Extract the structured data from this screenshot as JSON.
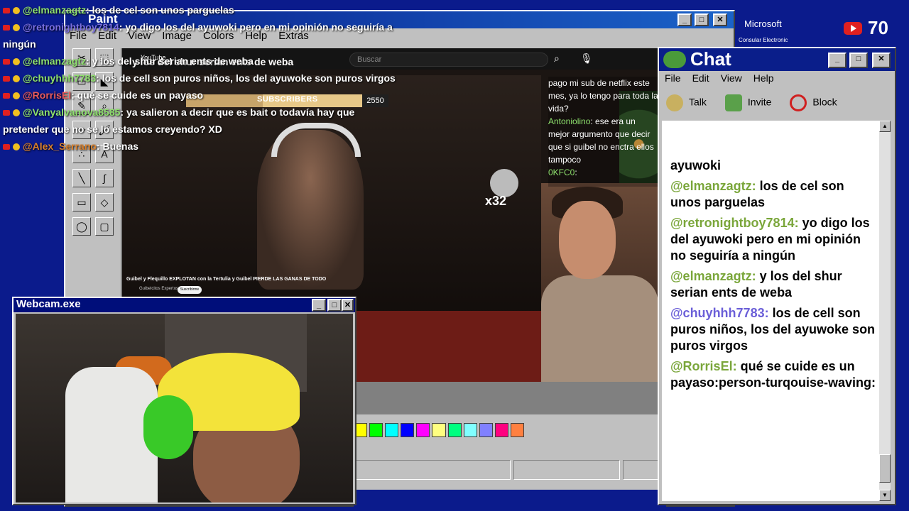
{
  "paint": {
    "title": "Paint",
    "menu": [
      "File",
      "Edit",
      "View",
      "Image",
      "Colors",
      "Help",
      "Extras"
    ],
    "palette": [
      "#ffff00",
      "#00ff00",
      "#00ffff",
      "#0000ff",
      "#ff00ff",
      "#ffff80",
      "#00ff80",
      "#80ffff",
      "#8080ff",
      "#ff0080",
      "#ff8040"
    ]
  },
  "stream": {
    "brand": "YouTube",
    "search_placeholder": "Buscar",
    "title": "y los del shur serian ents de weba",
    "subscribers_label": "SUBSCRIBERS",
    "subscribers_count": "2550",
    "subscribers_progress": 0.38,
    "sticker_text": "x32",
    "video_caption": "Guibel y Flequillo EXPLOTAN con la Tertulia y Guibel PIERDE LAS GANAS DE TODO",
    "channel": "Guibelcitos Expertos",
    "subscribe": "Suscribirme"
  },
  "side_chat": [
    {
      "text": "pago mi sub de netflix este mes, ya lo tengo para toda la vida?",
      "user": ""
    },
    {
      "user": "Antoniolino",
      "text": ": ese era un mejor argumento que decir que si guibel no enctra ellos tampoco"
    },
    {
      "user": "0KFC0",
      "text": ":"
    }
  ],
  "overlay_chat": [
    {
      "user": "@elmanzagtz",
      "text": ": los de cel son unos parguelas",
      "cls": "u1"
    },
    {
      "user": "@retronightboy7814",
      "text": ": yo digo los del ayuwoki pero en mi opinión no seguiría a ningún",
      "cls": "u2"
    },
    {
      "user": "@elmanzagtz",
      "text": ": y los del shur serian ents de weba",
      "cls": "u1"
    },
    {
      "user": "@chuyhhh7783",
      "text": ": los de cell son puros niños, los del ayuwoke son puros virgos",
      "cls": "u1"
    },
    {
      "user": "@RorrisEl",
      "text": ": qué se cuide es un payaso",
      "cls": "u3"
    },
    {
      "user": "@Vanyalvanova8585",
      "text": ": ya salieron a decir que es bait o todavía hay que pretender que no se lo estamos creyendo? XD",
      "cls": "u1"
    },
    {
      "user": "@Alex_Serrano",
      "text": ": Buenas",
      "cls": "u4"
    }
  ],
  "webcam": {
    "title": "Webcam.exe"
  },
  "chat": {
    "title": "Chat",
    "menu": [
      "File",
      "Edit",
      "View",
      "Help"
    ],
    "toolbar": [
      "Talk",
      "Invite",
      "Block"
    ],
    "messages": [
      {
        "user": "",
        "text": "ayuwoki",
        "color": "#000000"
      },
      {
        "user": "@elmanzagtz:",
        "text": " los de cel son unos parguelas",
        "color": "#7aa63a"
      },
      {
        "user": "@retronightboy7814:",
        "text": " yo digo los del ayuwoki pero en mi opinión no seguiría a ningún",
        "color": "#7aa63a"
      },
      {
        "user": "@elmanzagtz:",
        "text": " y los del shur serian ents de weba",
        "color": "#7aa63a"
      },
      {
        "user": "@chuyhhh7783:",
        "text": " los de cell son puros niños, los del ayuwoke son puros virgos",
        "color": "#6b5fd8"
      },
      {
        "user": "@RorrisEl:",
        "text": " qué se cuide es un payaso:person-turqouise-waving:",
        "color": "#7aa63a"
      }
    ]
  },
  "top_right": {
    "brand": "Microsoft",
    "sub": "Consular Electronic",
    "viewer_count": "70"
  }
}
